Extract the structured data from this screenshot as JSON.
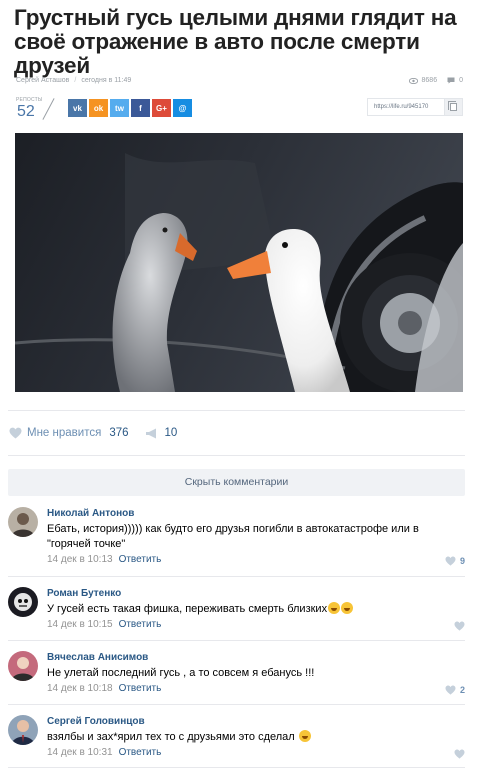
{
  "article": {
    "title": "Грустный гусь целыми днями глядит на своё отражение в авто после смерти друзей",
    "author": "Сергей Асташов",
    "time": "сегодня в 11:49",
    "views": "8686",
    "comments_count": "0"
  },
  "share": {
    "reposts_label": "РЕПОСТЫ",
    "reposts_count": "52",
    "buttons": [
      {
        "name": "vk",
        "glyph": "vk",
        "color": "#4a76a8"
      },
      {
        "name": "odnoklassniki",
        "glyph": "ok",
        "color": "#f59322"
      },
      {
        "name": "twitter",
        "glyph": "tw",
        "color": "#55acee"
      },
      {
        "name": "facebook",
        "glyph": "f",
        "color": "#3b5998"
      },
      {
        "name": "google-plus",
        "glyph": "G+",
        "color": "#dd4b39"
      },
      {
        "name": "email",
        "glyph": "@",
        "color": "#168de2"
      }
    ],
    "url": "https://life.ru/945170"
  },
  "post": {
    "like_label": "Мне нравится",
    "like_count": "376",
    "share_count": "10"
  },
  "comments_toggle": "Скрыть комментарии",
  "comments": [
    {
      "author": "Николай Антонов",
      "text": "Ебать, история))))) как будто его друзья погибли в автокатастрофе или в \"горячей точке\"",
      "date": "14 дек в 10:13",
      "reply": "Ответить",
      "likes": "9"
    },
    {
      "author": "Роман Бутенко",
      "text": "У гусей есть такая фишка, переживать смерть близких",
      "date": "14 дек в 10:15",
      "reply": "Ответить",
      "likes": ""
    },
    {
      "author": "Вячеслав Анисимов",
      "text": "Не улетай последний гусь , а то совсем я ебанусь !!!",
      "date": "14 дек в 10:18",
      "reply": "Ответить",
      "likes": "2"
    },
    {
      "author": "Сергей Головинцов",
      "text": "взялбы и зах*ярил тех то с друзьями это сделал",
      "date": "14 дек в 10:31",
      "reply": "Ответить",
      "likes": ""
    }
  ]
}
